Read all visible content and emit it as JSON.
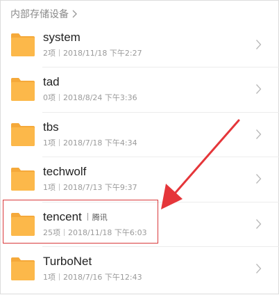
{
  "breadcrumb": {
    "label": "内部存储设备"
  },
  "folders": [
    {
      "name": "system",
      "count": "2项",
      "date": "2018/11/18 下午2:27",
      "tag": ""
    },
    {
      "name": "tad",
      "count": "0项",
      "date": "2018/8/24 下午3:36",
      "tag": ""
    },
    {
      "name": "tbs",
      "count": "1项",
      "date": "2018/7/18 下午4:34",
      "tag": ""
    },
    {
      "name": "techwolf",
      "count": "1项",
      "date": "2018/7/13 下午9:37",
      "tag": ""
    },
    {
      "name": "tencent",
      "count": "25项",
      "date": "2018/11/18 下午6:03",
      "tag": "腾讯"
    },
    {
      "name": "TurboNet",
      "count": "1项",
      "date": "2018/7/16 下午12:43",
      "tag": ""
    }
  ],
  "colors": {
    "folder": "#fcb84a",
    "folder_tab": "#f5a93a",
    "annotation": "#e5363a"
  }
}
